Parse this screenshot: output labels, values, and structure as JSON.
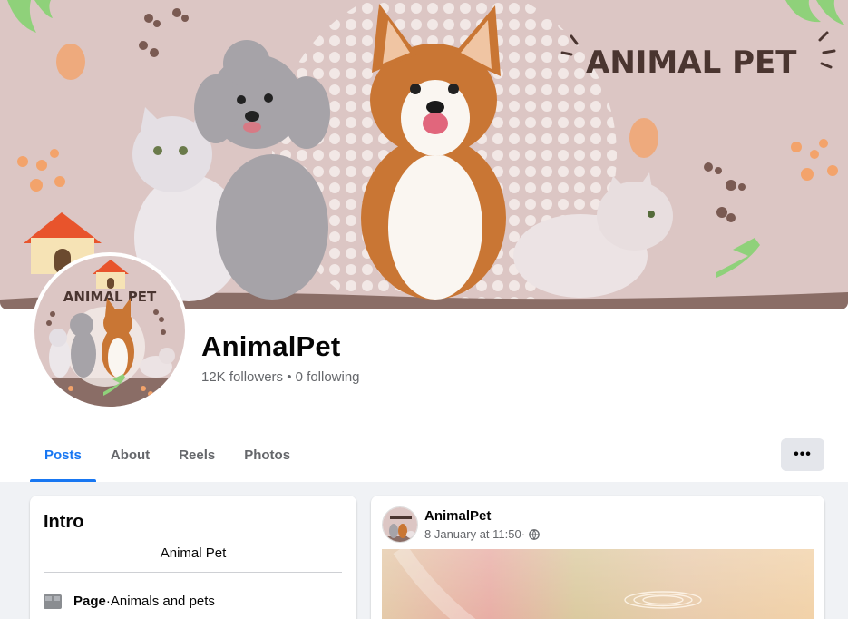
{
  "cover": {
    "banner_text": "ANIMAL PET"
  },
  "profile": {
    "name": "AnimalPet",
    "followers_text": "12K followers",
    "separator": " • ",
    "following_text": "0 following",
    "avatar_text": "ANIMAL PET"
  },
  "tabs": [
    {
      "label": "Posts",
      "active": true
    },
    {
      "label": "About",
      "active": false
    },
    {
      "label": "Reels",
      "active": false
    },
    {
      "label": "Photos",
      "active": false
    }
  ],
  "more_button": {
    "label": "•••"
  },
  "intro": {
    "title": "Intro",
    "bio": "Animal Pet",
    "category_label": "Page",
    "category_sep": " · ",
    "category_value": "Animals and pets"
  },
  "post": {
    "author": "AnimalPet",
    "timestamp": "8 January at 11:50",
    "meta_sep": " · ",
    "privacy_icon": "globe-icon"
  },
  "colors": {
    "accent": "#1877f2",
    "cover_bg": "#dcc6c4",
    "cover_ground": "#8a6d66",
    "banner_text": "#4a3530",
    "paw_orange": "#f3a36b",
    "paw_brown": "#7a5a52",
    "leaf_green": "#8fd17a"
  }
}
